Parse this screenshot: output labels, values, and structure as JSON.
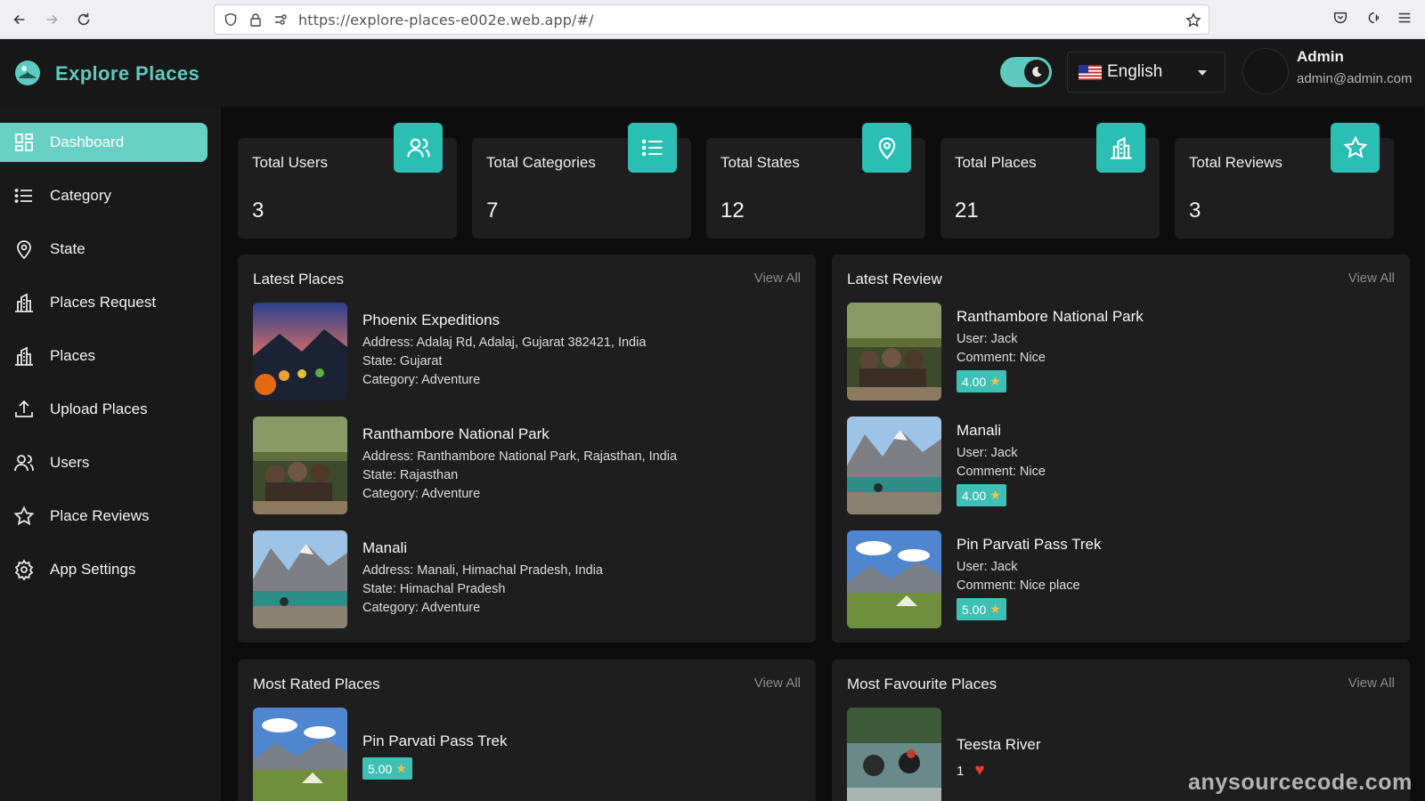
{
  "browser": {
    "url": "https://explore-places-e002e.web.app/#/"
  },
  "header": {
    "app_title": "Explore Places",
    "language": "English",
    "user_name": "Admin",
    "user_email": "admin@admin.com",
    "accent_color": "#5ec9bf"
  },
  "sidebar": {
    "items": [
      {
        "label": "Dashboard",
        "icon": "grid-icon",
        "active": true
      },
      {
        "label": "Category",
        "icon": "list-icon"
      },
      {
        "label": "State",
        "icon": "location-pin-icon"
      },
      {
        "label": "Places Request",
        "icon": "building-icon"
      },
      {
        "label": "Places",
        "icon": "building-icon"
      },
      {
        "label": "Upload Places",
        "icon": "upload-icon"
      },
      {
        "label": "Users",
        "icon": "users-icon"
      },
      {
        "label": "Place Reviews",
        "icon": "star-icon"
      },
      {
        "label": "App Settings",
        "icon": "gear-icon"
      }
    ]
  },
  "stats": [
    {
      "label": "Total Users",
      "value": "3",
      "icon": "users-icon"
    },
    {
      "label": "Total Categories",
      "value": "7",
      "icon": "list-icon"
    },
    {
      "label": "Total States",
      "value": "12",
      "icon": "location-pin-icon"
    },
    {
      "label": "Total Places",
      "value": "21",
      "icon": "building-icon"
    },
    {
      "label": "Total Reviews",
      "value": "3",
      "icon": "star-icon"
    }
  ],
  "latest_places": {
    "title": "Latest Places",
    "view_all": "View All",
    "items": [
      {
        "name": "Phoenix Expeditions",
        "address": "Address: Adalaj Rd, Adalaj, Gujarat 382421, India",
        "state": "State: Gujarat",
        "category": "Category: Adventure"
      },
      {
        "name": "Ranthambore National Park",
        "address": "Address: Ranthambore National Park, Rajasthan, India",
        "state": "State: Rajasthan",
        "category": "Category: Adventure"
      },
      {
        "name": "Manali",
        "address": "Address: Manali, Himachal Pradesh, India",
        "state": "State: Himachal Pradesh",
        "category": "Category: Adventure"
      }
    ]
  },
  "latest_review": {
    "title": "Latest Review",
    "view_all": "View All",
    "items": [
      {
        "name": "Ranthambore National Park",
        "user": "User: Jack",
        "comment": "Comment: Nice",
        "rating": "4.00"
      },
      {
        "name": "Manali",
        "user": "User: Jack",
        "comment": "Comment: Nice",
        "rating": "4.00"
      },
      {
        "name": "Pin Parvati Pass Trek",
        "user": "User: Jack",
        "comment": "Comment: Nice place",
        "rating": "5.00"
      }
    ]
  },
  "most_rated": {
    "title": "Most Rated Places",
    "view_all": "View All",
    "items": [
      {
        "name": "Pin Parvati Pass Trek",
        "rating": "5.00"
      }
    ]
  },
  "most_favourite": {
    "title": "Most Favourite Places",
    "view_all": "View All",
    "items": [
      {
        "name": "Teesta River",
        "count": "1"
      }
    ]
  },
  "watermark": "anysourcecode.com"
}
